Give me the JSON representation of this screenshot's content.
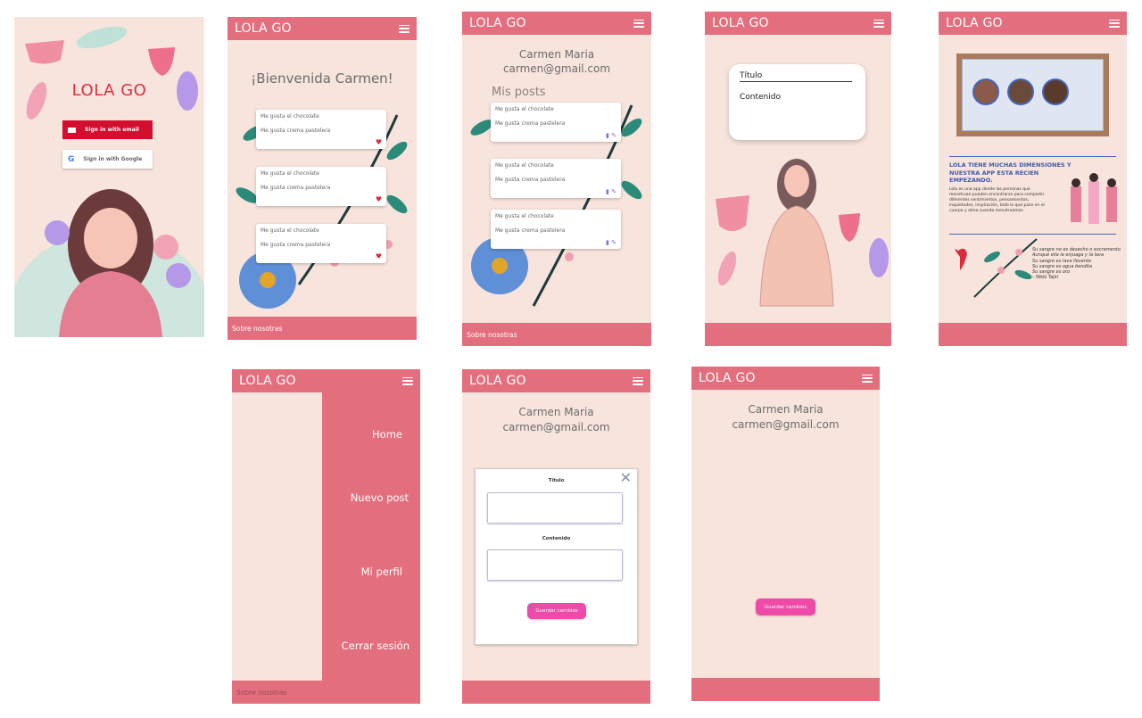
{
  "app": {
    "brand": "LOLA GO"
  },
  "login": {
    "title": "LOLA GO",
    "email_btn": "Sign in with email",
    "google_btn": "Sign in with Google"
  },
  "home": {
    "welcome": "¡Bienvenida Carmen!",
    "posts": [
      {
        "title": "Me gusta el chocolate",
        "content": "Me gusta crema pastelera"
      },
      {
        "title": "Me gusta el chocolate",
        "content": "Me gusta crema pastelera"
      },
      {
        "title": "Me gusta el chocolate",
        "content": "Me gusta crema pastelera"
      }
    ],
    "footer": "Sobre nosotras"
  },
  "profile": {
    "name": "Carmen Maria",
    "email": "carmen@gmail.com",
    "section": "Mis posts",
    "posts": [
      {
        "title": "Me gusta el chocolate",
        "content": "Me gusta crema pastelera"
      },
      {
        "title": "Me gusta el chocolate",
        "content": "Me gusta crema pastelera"
      },
      {
        "title": "Me gusta el chocolate",
        "content": "Me gusta crema pastelera"
      }
    ],
    "footer": "Sobre nosotras"
  },
  "new_post": {
    "title_placeholder": "Título",
    "content_placeholder": "Contenido"
  },
  "about": {
    "heading": "LOLA TIENE MUCHAS DIMENSIONES Y NUESTRA APP ESTA RECIEN EMPEZANDO.",
    "body": "Lola es una app donde las personas que menstruan pueden encontrarse para compartir diferentes sentimientos, pensamientos, inquietudes, inspiración, todo lo que pase en el cuerpo y alma cuando menstruamos",
    "poem": [
      "Su sangre no es desecho o excremento",
      "Aunque ella la enjuaga y la lava",
      "Su sangre es lava llovente",
      "Su sangre es agua bendita",
      "Su sangre es oro",
      "– Nikki Tajiri"
    ]
  },
  "menu": {
    "items": [
      "Home",
      "Nuevo post",
      "Mi perfil",
      "Cerrar sesión"
    ],
    "footer": "Sobre nosotras"
  },
  "edit_modal": {
    "name": "Carmen Maria",
    "email": "carmen@gmail.com",
    "label_title": "Título",
    "label_content": "Contenido",
    "save": "Guardar cambios"
  },
  "edit_empty": {
    "name": "Carmen Maria",
    "email": "carmen@gmail.com",
    "save": "Guardar cambios"
  },
  "colors": {
    "accent": "#e36f7e",
    "bg": "#f7e4dc",
    "google_red": "#d20f2e",
    "save_pink": "#ee4aa8"
  }
}
